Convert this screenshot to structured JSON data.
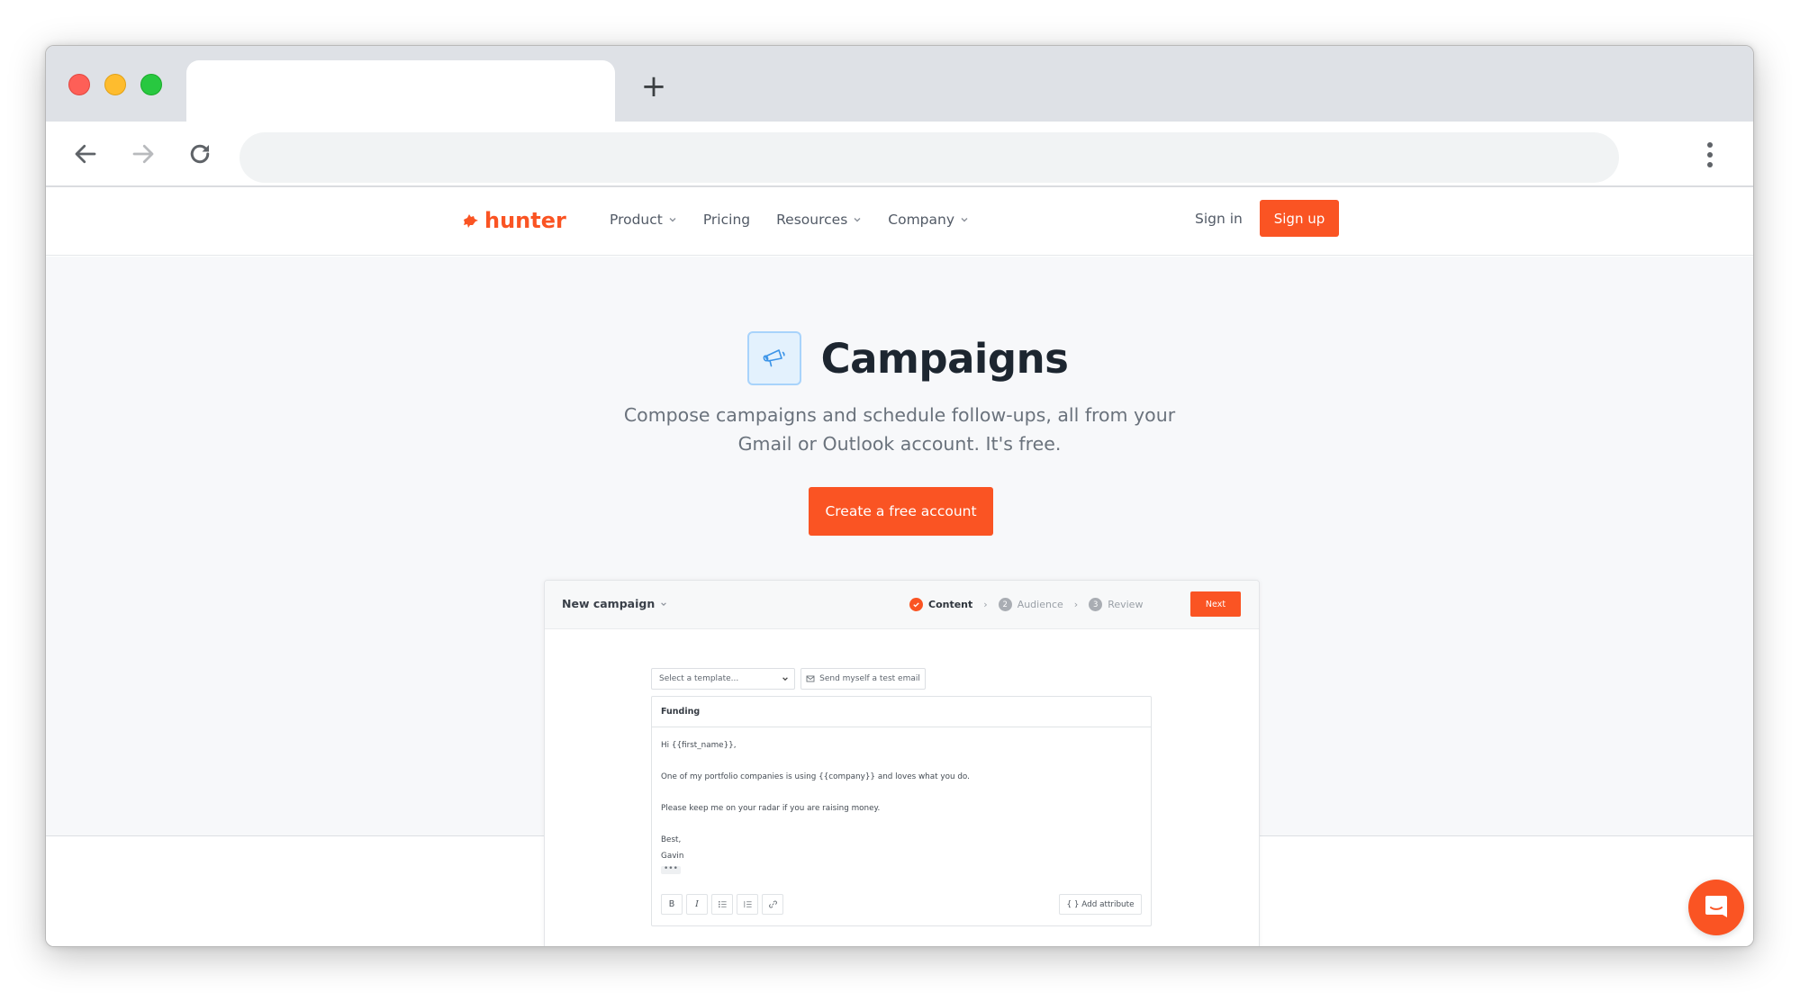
{
  "browser": {
    "tab_title": "",
    "new_tab_label": "+",
    "address": "",
    "icons": {
      "back": "arrow-left-icon",
      "forward": "arrow-right-icon",
      "reload": "reload-icon",
      "menu": "kebab-menu-icon"
    }
  },
  "site_nav": {
    "brand": "hunter",
    "menu": [
      {
        "label": "Product",
        "has_dropdown": true
      },
      {
        "label": "Pricing",
        "has_dropdown": false
      },
      {
        "label": "Resources",
        "has_dropdown": true
      },
      {
        "label": "Company",
        "has_dropdown": true
      }
    ],
    "sign_in": "Sign in",
    "sign_up": "Sign up"
  },
  "hero": {
    "icon": "megaphone-icon",
    "title": "Campaigns",
    "subtitle_line1": "Compose campaigns and schedule follow-ups, all from your",
    "subtitle_line2": "Gmail or Outlook account. It's free.",
    "cta": "Create a free account"
  },
  "campaign_preview": {
    "title": "New campaign",
    "steps": [
      {
        "number": "1",
        "label": "Content",
        "status": "done"
      },
      {
        "number": "2",
        "label": "Audience",
        "status": "todo"
      },
      {
        "number": "3",
        "label": "Review",
        "status": "todo"
      }
    ],
    "next_label": "Next",
    "template_select": {
      "value": "Select a template..."
    },
    "test_email_label": "Send myself a test email",
    "subject": "Funding",
    "body": {
      "greeting": "Hi {{first_name}},",
      "line1": "One of my portfolio companies is using {{company}} and loves what you do.",
      "line2": "Please keep me on your radar if you are raising money.",
      "signoff": "Best,",
      "signature": "Gavin",
      "ellipsis": "•••"
    },
    "format_buttons": [
      {
        "label": "B",
        "name": "bold"
      },
      {
        "label": "I",
        "name": "italic"
      },
      {
        "label": "",
        "name": "bullet-list"
      },
      {
        "label": "",
        "name": "numbered-list"
      },
      {
        "label": "",
        "name": "link"
      }
    ],
    "add_attribute_label": "{ } Add attribute"
  },
  "colors": {
    "brand": "#fa5423",
    "hero_bg": "#f7f8fa",
    "icon_bg": "#e3f1fd",
    "icon_stroke": "#3b94e8"
  },
  "chat": {
    "icon": "chat-icon"
  }
}
